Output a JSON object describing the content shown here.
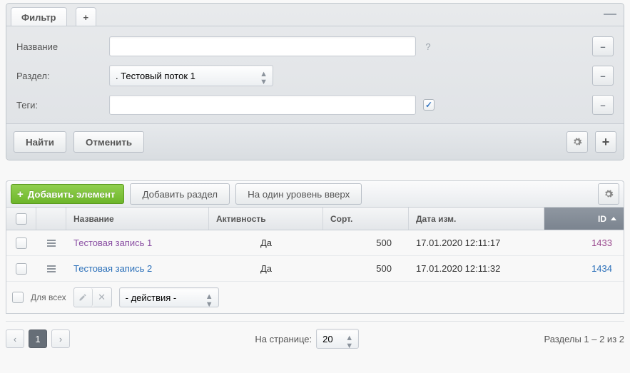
{
  "filter": {
    "tab_label": "Фильтр",
    "name_label": "Название",
    "razdel_label": "Раздел:",
    "tags_label": "Теги:",
    "name_value": "",
    "razdel_selected": ". Тестовый поток 1",
    "tags_value": "",
    "tags_checked": true,
    "find": "Найти",
    "cancel": "Отменить"
  },
  "toolbar": {
    "add_element": "Добавить элемент",
    "add_section": "Добавить раздел",
    "level_up": "На один уровень вверх"
  },
  "columns": {
    "name": "Название",
    "activity": "Активность",
    "sort": "Сорт.",
    "date": "Дата изм.",
    "id": "ID"
  },
  "rows": [
    {
      "name": "Тестовая запись 1",
      "active": "Да",
      "sort": "500",
      "date": "17.01.2020 12:11:17",
      "id": "1433",
      "visited": true
    },
    {
      "name": "Тестовая запись 2",
      "active": "Да",
      "sort": "500",
      "date": "17.01.2020 12:11:32",
      "id": "1434",
      "visited": false
    }
  ],
  "footer": {
    "for_all": "Для всех",
    "actions_placeholder": "- действия -"
  },
  "pager": {
    "per_page_label": "На странице:",
    "per_page_value": "20",
    "current": "1",
    "summary": "Разделы 1 – 2 из 2"
  }
}
